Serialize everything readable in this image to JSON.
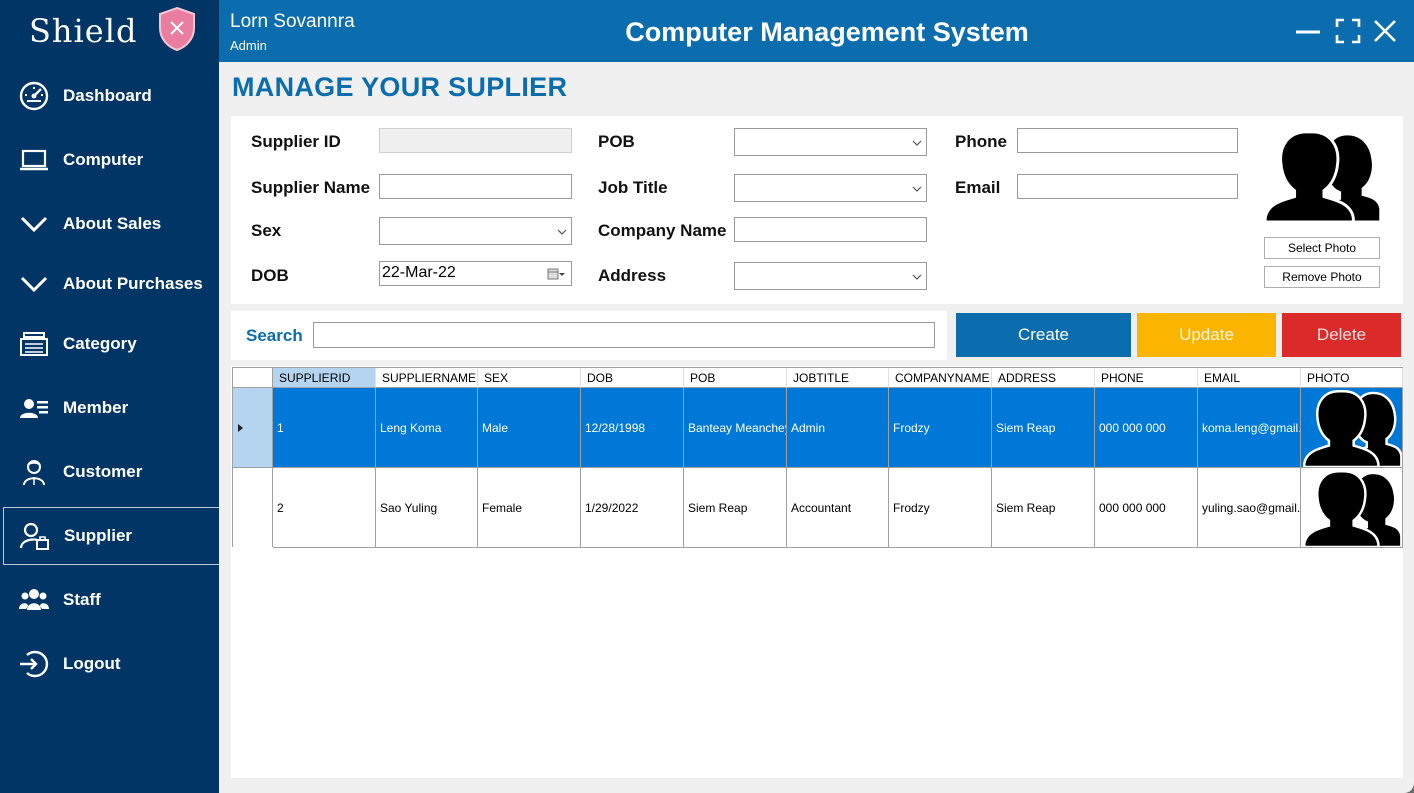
{
  "brand": {
    "name": "Shield"
  },
  "user": {
    "name": "Lorn Sovannra",
    "role": "Admin"
  },
  "app_title": "Computer Management System",
  "window": {
    "minimize_icon": "minimize-icon",
    "maximize_icon": "maximize-icon",
    "close_icon": "close-icon"
  },
  "sidebar": {
    "items": [
      {
        "label": "Dashboard",
        "icon": "speedometer-icon"
      },
      {
        "label": "Computer",
        "icon": "laptop-icon"
      },
      {
        "label": "About Sales",
        "icon": "chevron-down-icon"
      },
      {
        "label": "About Purchases",
        "icon": "chevron-down-icon"
      },
      {
        "label": "Category",
        "icon": "category-icon"
      },
      {
        "label": "Member",
        "icon": "member-icon"
      },
      {
        "label": "Customer",
        "icon": "customer-icon"
      },
      {
        "label": "Supplier",
        "icon": "supplier-icon",
        "active": true
      },
      {
        "label": "Staff",
        "icon": "staff-icon"
      },
      {
        "label": "Logout",
        "icon": "logout-icon"
      }
    ]
  },
  "page_title": "MANAGE YOUR SUPLIER",
  "form": {
    "supplier_id": {
      "label": "Supplier ID",
      "value": ""
    },
    "supplier_name": {
      "label": "Supplier Name",
      "value": ""
    },
    "sex": {
      "label": "Sex",
      "value": ""
    },
    "dob": {
      "label": "DOB",
      "value": "22-Mar-22"
    },
    "pob": {
      "label": "POB",
      "value": ""
    },
    "job_title": {
      "label": "Job Title",
      "value": ""
    },
    "company_name": {
      "label": "Company Name",
      "value": ""
    },
    "address": {
      "label": "Address",
      "value": ""
    },
    "phone": {
      "label": "Phone",
      "value": ""
    },
    "email": {
      "label": "Email",
      "value": ""
    },
    "select_photo": "Select Photo",
    "remove_photo": "Remove Photo"
  },
  "search": {
    "label": "Search",
    "value": ""
  },
  "actions": {
    "create": "Create",
    "update": "Update",
    "delete": "Delete"
  },
  "colors": {
    "sidebar": "#003566",
    "topbar": "#0b6dad",
    "create": "#0b6dad",
    "update": "#fbb400",
    "delete": "#db2a2a",
    "selected_row": "#0078d7"
  },
  "grid": {
    "columns": [
      "SUPPLIERID",
      "SUPPLIERNAME",
      "SEX",
      "DOB",
      "POB",
      "JOBTITLE",
      "COMPANYNAME",
      "ADDRESS",
      "PHONE",
      "EMAIL",
      "PHOTO"
    ],
    "rows": [
      [
        "1",
        "Leng Koma",
        "Male",
        "12/28/1998",
        "Banteay Meanchey",
        "Admin",
        "Frodzy",
        "Siem Reap",
        "000 000 000",
        "koma.leng@gmail...."
      ],
      [
        "2",
        "Sao Yuling",
        "Female",
        "1/29/2022",
        "Siem Reap",
        "Accountant",
        "Frodzy",
        "Siem Reap",
        "000 000 000",
        "yuling.sao@gmail...."
      ]
    ]
  }
}
